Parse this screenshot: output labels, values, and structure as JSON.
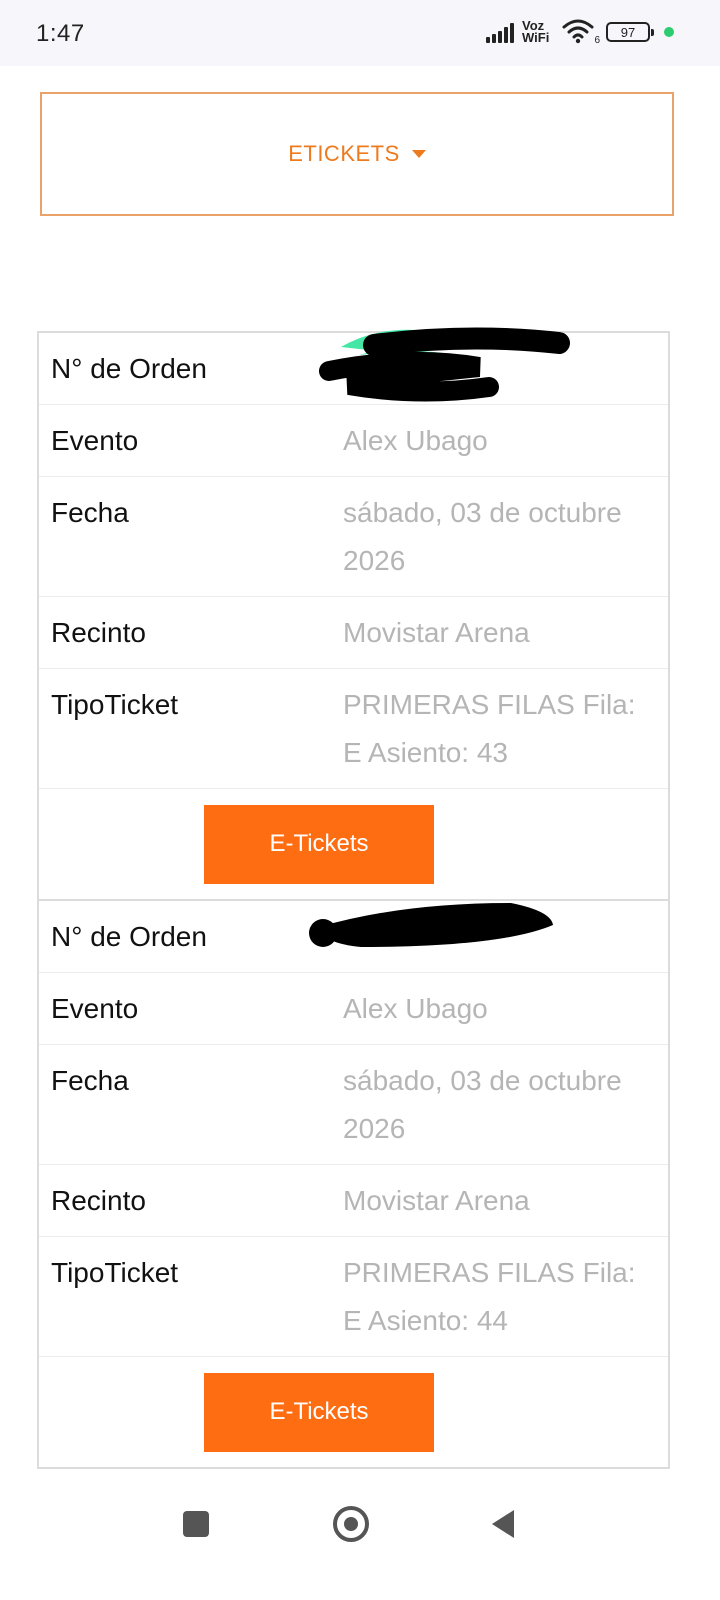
{
  "status_bar": {
    "time": "1:47",
    "network": "Voz WiFi",
    "wifi_sub": "6",
    "battery": "97"
  },
  "dropdown": {
    "label": "ETICKETS"
  },
  "orders": [
    {
      "order_label": "N° de Orden",
      "event_label": "Evento",
      "event": "Alex Ubago",
      "date_label": "Fecha",
      "date": "sábado, 03 de octubre 2026",
      "venue_label": "Recinto",
      "venue": "Movistar Arena",
      "type_label": "TipoTicket",
      "type": "PRIMERAS FILAS Fila: E Asiento: 43",
      "button": "E-Tickets"
    },
    {
      "order_label": "N° de Orden",
      "event_label": "Evento",
      "event": "Alex Ubago",
      "date_label": "Fecha",
      "date": "sábado, 03 de octubre 2026",
      "venue_label": "Recinto",
      "venue": "Movistar Arena",
      "type_label": "TipoTicket",
      "type": "PRIMERAS FILAS Fila: E Asiento: 44",
      "button": "E-Tickets"
    }
  ],
  "colors": {
    "accent": "#ff6d12",
    "dropdown_text": "#ee7a1e",
    "value_text": "#b5b5b5"
  }
}
